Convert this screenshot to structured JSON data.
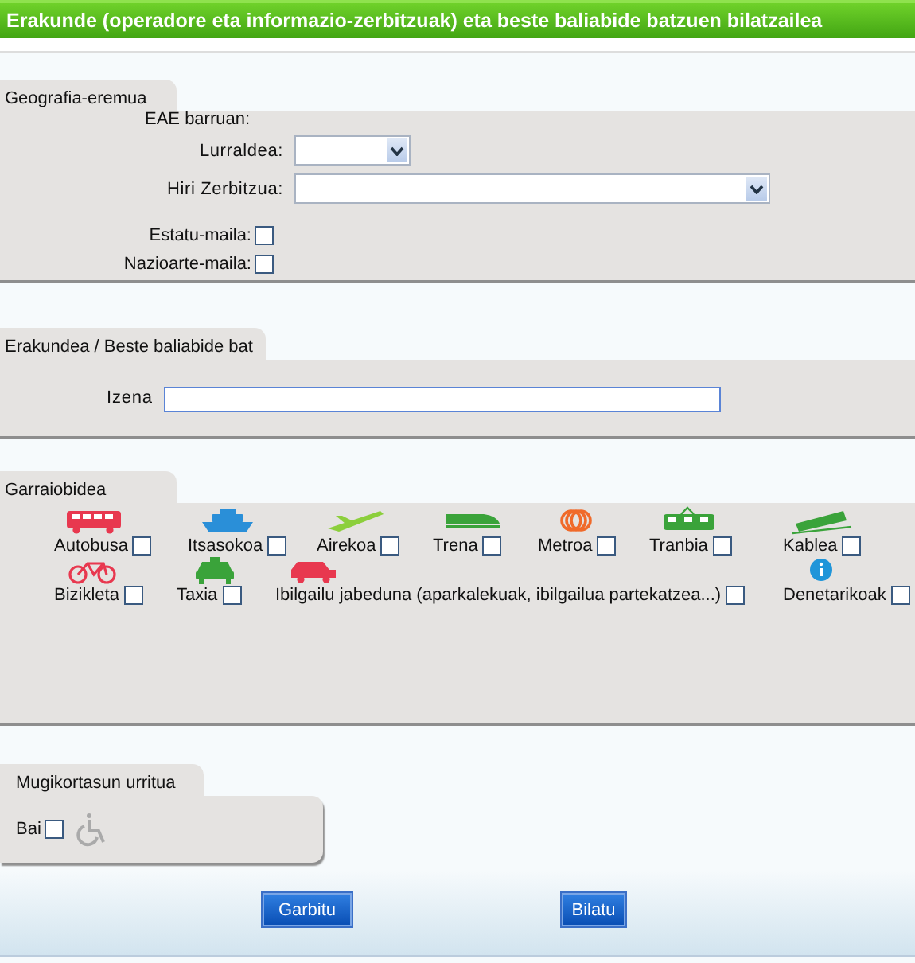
{
  "header": {
    "title": "Erakunde (operadore eta informazio-zerbitzuak) eta beste baliabide batzuen bilatzailea"
  },
  "geography": {
    "title": "Geografia-eremua",
    "subtitle": "EAE barruan:",
    "selects": [
      {
        "label": "Lurraldea:",
        "kind": "short"
      },
      {
        "label": "Hiri Zerbitzua:",
        "kind": "long"
      }
    ],
    "checks": [
      {
        "label": "Estatu-maila:",
        "checked": false
      },
      {
        "label": "Nazioarte-maila:",
        "checked": false
      }
    ]
  },
  "organization": {
    "title": "Erakundea / Beste baliabide bat",
    "label": "Izena"
  },
  "transport": {
    "title": "Garraiobidea",
    "options": [
      {
        "label": "Autobusa",
        "kind": "bus",
        "checked": false
      },
      {
        "label": "Itsasokoa",
        "kind": "ship",
        "checked": false
      },
      {
        "label": "Airekoa",
        "kind": "plane",
        "checked": false
      },
      {
        "label": "Trena",
        "kind": "train",
        "checked": false
      },
      {
        "label": "Metroa",
        "kind": "metro",
        "checked": false
      },
      {
        "label": "Tranbia",
        "kind": "tram",
        "checked": false
      },
      {
        "label": "Kablea",
        "kind": "cable",
        "checked": false
      },
      {
        "label": "Bizikleta",
        "kind": "bike",
        "checked": false
      },
      {
        "label": "Taxia",
        "kind": "taxi",
        "checked": false
      },
      {
        "label": "Ibilgailu jabeduna (aparkalekuak, ibilgailua partekatzea...)",
        "kind": "car",
        "checked": false
      },
      {
        "label": "Denetarikoak",
        "kind": "info",
        "checked": false
      }
    ]
  },
  "mobility": {
    "title": "Mugikortasun urritua",
    "label": "Bai",
    "checked": false
  },
  "buttons": [
    {
      "label": "Garbitu"
    },
    {
      "label": "Bilatu"
    }
  ]
}
